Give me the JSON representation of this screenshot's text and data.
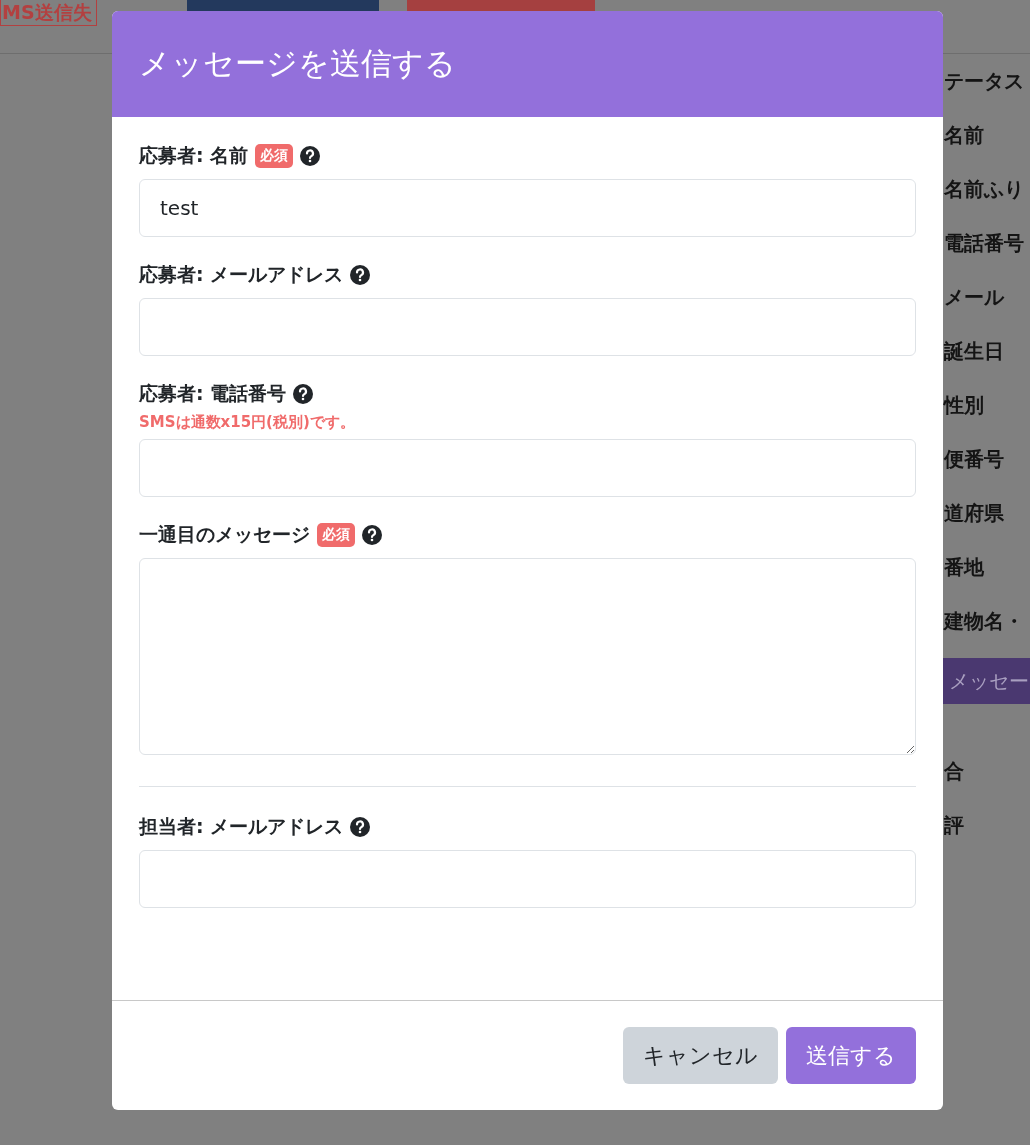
{
  "background": {
    "top_buttons": [
      {
        "label": "MS送信失",
        "kind": "outline"
      },
      {
        "kind": "blue"
      },
      {
        "kind": "red"
      }
    ],
    "side_items": [
      {
        "label": "テータス",
        "kind": "label"
      },
      {
        "label": "名前",
        "kind": "label"
      },
      {
        "label": "名前ふり",
        "kind": "label"
      },
      {
        "label": "電話番号",
        "kind": "label"
      },
      {
        "label": "メール",
        "kind": "label"
      },
      {
        "label": "誕生日",
        "kind": "label"
      },
      {
        "label": "性別",
        "kind": "label"
      },
      {
        "label": "便番号",
        "kind": "label"
      },
      {
        "label": "道府県",
        "kind": "label"
      },
      {
        "label": "番地",
        "kind": "label"
      },
      {
        "label": "建物名・",
        "kind": "label"
      },
      {
        "label": "メッセー",
        "kind": "button"
      },
      {
        "label": "合",
        "kind": "label"
      },
      {
        "label": "評",
        "kind": "label"
      }
    ]
  },
  "modal": {
    "title": "メッセージを送信する",
    "fields": [
      {
        "label": "応募者: 名前",
        "required": true,
        "badge": "必須",
        "kind": "input",
        "value": "test"
      },
      {
        "label": "応募者: メールアドレス",
        "required": false,
        "kind": "input"
      },
      {
        "label": "応募者: 電話番号",
        "required": false,
        "kind": "input",
        "note": "SMSは通数x15円(税別)です。"
      },
      {
        "label": "一通目のメッセージ",
        "required": true,
        "badge": "必須",
        "kind": "textarea"
      },
      {
        "label": "担当者: メールアドレス",
        "required": false,
        "kind": "input",
        "divider_before": true
      }
    ],
    "buttons": [
      {
        "label": "キャンセル",
        "kind": "secondary"
      },
      {
        "label": "送信する",
        "kind": "primary"
      }
    ]
  }
}
